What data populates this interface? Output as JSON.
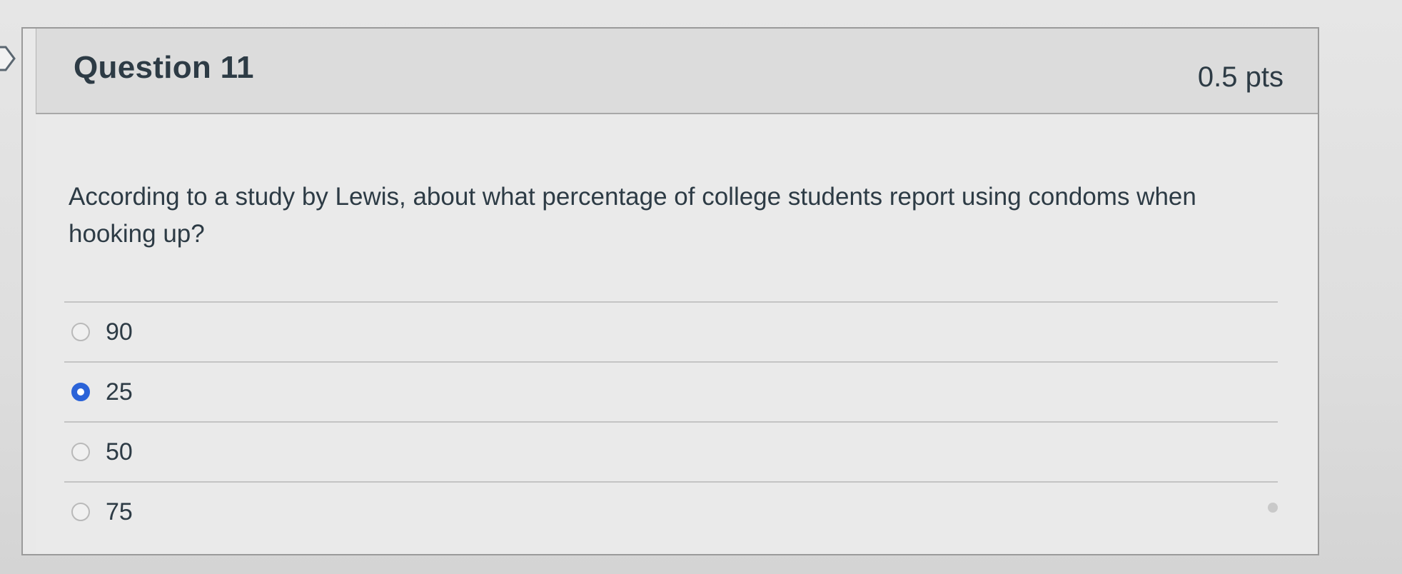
{
  "question": {
    "title": "Question 11",
    "points": "0.5 pts",
    "text": "According to a study by Lewis, about what percentage of college students report using condoms when hooking up?"
  },
  "answers": [
    {
      "label": "90",
      "selected": false
    },
    {
      "label": "25",
      "selected": true
    },
    {
      "label": "50",
      "selected": false
    },
    {
      "label": "75",
      "selected": false
    }
  ],
  "colors": {
    "selected_radio": "#2b63d8",
    "text": "#2d3b45"
  },
  "icons": {
    "nav_flag": "bookmark-flag-icon"
  }
}
